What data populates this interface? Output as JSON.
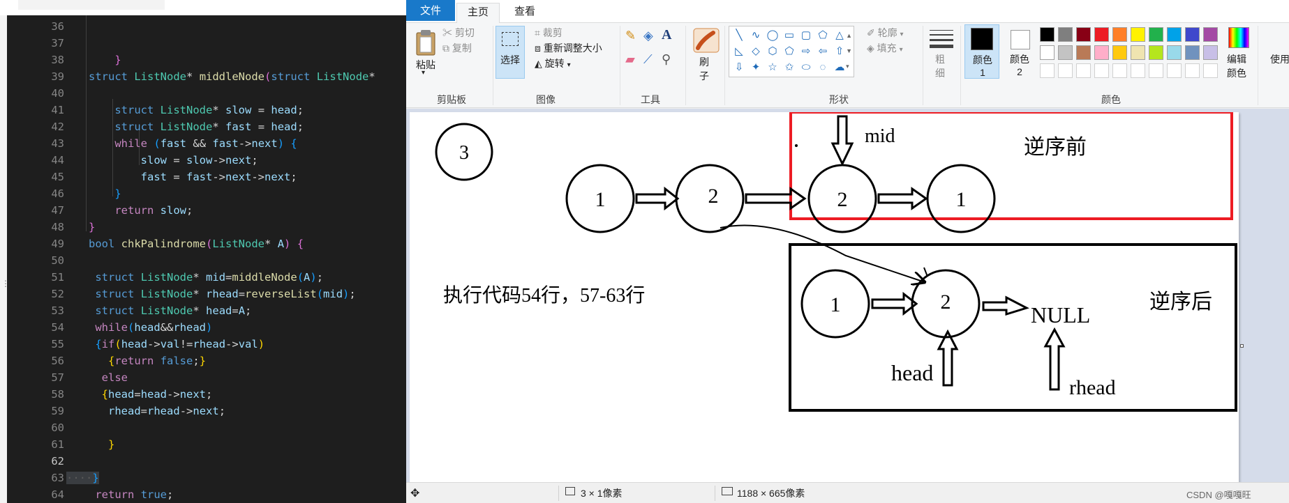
{
  "editor": {
    "lines": [
      {
        "num": "36",
        "html": ""
      },
      {
        "num": "37",
        "html": ""
      },
      {
        "num": "38",
        "html": "    <span class='b2'>}</span>"
      },
      {
        "num": "39",
        "html": "<span class='k'>struct</span> <span class='t'>ListNode</span><span class='o'>*</span> <span class='f'>middleNode</span><span class='b2'>(</span><span class='k'>struct</span> <span class='t'>ListNode</span><span class='o'>*</span>"
      },
      {
        "num": "40",
        "html": ""
      },
      {
        "num": "41",
        "html": "    <span class='k'>struct</span> <span class='t'>ListNode</span><span class='o'>*</span> <span class='v'>slow</span> <span class='o'>=</span> <span class='v'>head</span><span class='o'>;</span>"
      },
      {
        "num": "42",
        "html": "    <span class='k'>struct</span> <span class='t'>ListNode</span><span class='o'>*</span> <span class='v'>fast</span> <span class='o'>=</span> <span class='v'>head</span><span class='o'>;</span>"
      },
      {
        "num": "43",
        "html": "    <span class='c'>while</span> <span class='b3'>(</span><span class='v'>fast</span> <span class='o'>&amp;&amp;</span> <span class='v'>fast</span><span class='o'>-&gt;</span><span class='v'>next</span><span class='b3'>)</span> <span class='b3'>{</span>"
      },
      {
        "num": "44",
        "html": "        <span class='v'>slow</span> <span class='o'>=</span> <span class='v'>slow</span><span class='o'>-&gt;</span><span class='v'>next</span><span class='o'>;</span>"
      },
      {
        "num": "45",
        "html": "        <span class='v'>fast</span> <span class='o'>=</span> <span class='v'>fast</span><span class='o'>-&gt;</span><span class='v'>next</span><span class='o'>-&gt;</span><span class='v'>next</span><span class='o'>;</span>"
      },
      {
        "num": "46",
        "html": "    <span class='b3'>}</span>"
      },
      {
        "num": "47",
        "html": "    <span class='c'>return</span> <span class='v'>slow</span><span class='o'>;</span>"
      },
      {
        "num": "48",
        "html": "<span class='b2'>}</span>"
      },
      {
        "num": "49",
        "html": "<span class='k'>bool</span> <span class='f'>chkPalindrome</span><span class='b2'>(</span><span class='t'>ListNode</span><span class='o'>*</span> <span class='v'>A</span><span class='b2'>)</span> <span class='b2'>{</span>"
      },
      {
        "num": "50",
        "html": ""
      },
      {
        "num": "51",
        "html": " <span class='k'>struct</span> <span class='t'>ListNode</span><span class='o'>*</span> <span class='v'>mid</span><span class='o'>=</span><span class='f'>middleNode</span><span class='b3'>(</span><span class='v'>A</span><span class='b3'>)</span><span class='o'>;</span>"
      },
      {
        "num": "52",
        "html": " <span class='k'>struct</span> <span class='t'>ListNode</span><span class='o'>*</span> <span class='v'>rhead</span><span class='o'>=</span><span class='f'>reverseList</span><span class='b3'>(</span><span class='v'>mid</span><span class='b3'>)</span><span class='o'>;</span>"
      },
      {
        "num": "53",
        "html": " <span class='k'>struct</span> <span class='t'>ListNode</span><span class='o'>*</span> <span class='v'>head</span><span class='o'>=</span><span class='v'>A</span><span class='o'>;</span>"
      },
      {
        "num": "54",
        "html": " <span class='c'>while</span><span class='b3'>(</span><span class='v'>head</span><span class='o'>&amp;&amp;</span><span class='v'>rhead</span><span class='b3'>)</span>"
      },
      {
        "num": "55",
        "html": " <span class='b3'>{</span><span class='c'>if</span><span class='b1'>(</span><span class='v'>head</span><span class='o'>-&gt;</span><span class='v'>val</span><span class='o'>!=</span><span class='v'>rhead</span><span class='o'>-&gt;</span><span class='v'>val</span><span class='b1'>)</span>"
      },
      {
        "num": "56",
        "html": "   <span class='b1'>{</span><span class='c'>return</span> <span class='k'>false</span><span class='o'>;</span><span class='b1'>}</span>"
      },
      {
        "num": "57",
        "html": "  <span class='c'>else</span>"
      },
      {
        "num": "58",
        "html": "  <span class='b1'>{</span><span class='v'>head</span><span class='o'>=</span><span class='v'>head</span><span class='o'>-&gt;</span><span class='v'>next</span><span class='o'>;</span>"
      },
      {
        "num": "59",
        "html": "   <span class='v'>rhead</span><span class='o'>=</span><span class='v'>rhead</span><span class='o'>-&gt;</span><span class='v'>next</span><span class='o'>;</span>"
      },
      {
        "num": "60",
        "html": ""
      },
      {
        "num": "61",
        "html": "   <span class='b1'>}</span>"
      },
      {
        "num": "62",
        "html": ""
      },
      {
        "num": "63",
        "html": "<span class='ws hl'>····</span><span class='b3 hl'>}</span>"
      },
      {
        "num": "64",
        "html": " <span class='c'>return</span> <span class='k'>true</span><span class='o'>;</span>"
      }
    ],
    "active_line": "62"
  },
  "paint": {
    "menu": {
      "file": "文件",
      "home": "主页",
      "view": "查看"
    },
    "clipboard": {
      "paste": "粘贴",
      "cut": "剪切",
      "copy": "复制",
      "label": "剪贴板"
    },
    "image": {
      "select": "选择",
      "crop": "裁剪",
      "resize": "重新调整大小",
      "rotate": "旋转",
      "label": "图像"
    },
    "tools": {
      "label": "工具"
    },
    "brush": {
      "label": "刷子"
    },
    "shapes": {
      "outline": "轮廓",
      "fill": "填充",
      "label": "形状"
    },
    "size": {
      "label": "粗细"
    },
    "color1": {
      "label": "颜色 1"
    },
    "color2": {
      "label": "颜色 2"
    },
    "colors": {
      "label": "颜色",
      "edit": "编辑颜色",
      "use_3d": "使用",
      "row1": [
        "#000000",
        "#7f7f7f",
        "#880015",
        "#ed1c24",
        "#ff7f27",
        "#fff200",
        "#22b14c",
        "#00a2e8",
        "#3f48cc",
        "#a349a4"
      ],
      "row2": [
        "#ffffff",
        "#c3c3c3",
        "#b97a57",
        "#ffaec9",
        "#ffc90e",
        "#efe4b0",
        "#b5e61d",
        "#99d9ea",
        "#7092be",
        "#c8bfe7"
      ]
    },
    "status": {
      "selection_size": "3 × 1像素",
      "canvas_size": "1188 × 665像素",
      "watermark": "CSDN @嘎嘎旺"
    },
    "drawing": {
      "circle_top": "3",
      "mid_label": "mid",
      "before_label": "逆序前",
      "after_label": "逆序后",
      "exec_text": "执行代码54行，57-63行",
      "null_label": "NULL",
      "head_label": "head",
      "rhead_label": "rhead",
      "nodes_top": [
        "1",
        "2",
        "2",
        "1"
      ],
      "nodes_bottom": [
        "1",
        "2"
      ]
    }
  }
}
